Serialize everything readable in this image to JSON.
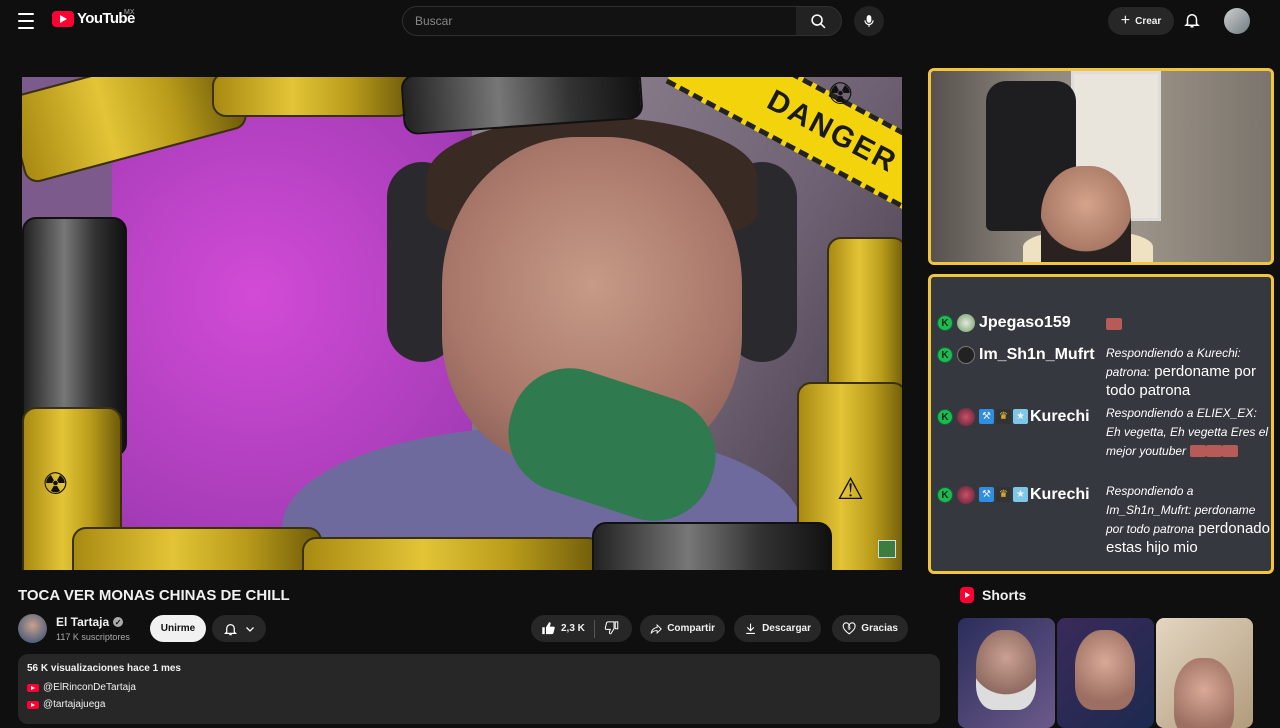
{
  "header": {
    "logo_text": "YouTube",
    "country": "MX",
    "search_placeholder": "Buscar",
    "create_label": "Crear"
  },
  "video": {
    "overlay_tape_text": "DANGER",
    "title": "TOCA VER MONAS CHINAS DE CHILL",
    "channel_name": "El Tartaja",
    "subscribers": "117 K suscriptores",
    "join_label": "Unirme",
    "likes": "2,3 K",
    "share_label": "Compartir",
    "download_label": "Descargar",
    "thanks_label": "Gracias"
  },
  "description": {
    "meta": "56 K visualizaciones  hace 1 mes",
    "links": [
      "@ElRinconDeTartaja",
      "@tartajajuega"
    ]
  },
  "chat": {
    "messages": [
      {
        "user": "Jpegaso159",
        "reply": "",
        "text": ""
      },
      {
        "user": "Im_Sh1n_Mufrt",
        "reply": "Respondiendo a Kurechi: patrona:",
        "text": "perdoname por todo patrona"
      },
      {
        "user": "Kurechi",
        "reply": "Respondiendo a ELIEX_EX: Eh vegetta, Eh vegetta Eres el mejor youtuber",
        "text": ""
      },
      {
        "user": "Kurechi",
        "reply": "Respondiendo a Im_Sh1n_Mufrt: perdoname por todo patrona",
        "text": "perdonado estas hijo mio"
      }
    ]
  },
  "shorts": {
    "label": "Shorts"
  },
  "colors": {
    "accent": "#ff0033",
    "overlay_border": "#f2c53c",
    "chat_bg": "#35393f"
  }
}
